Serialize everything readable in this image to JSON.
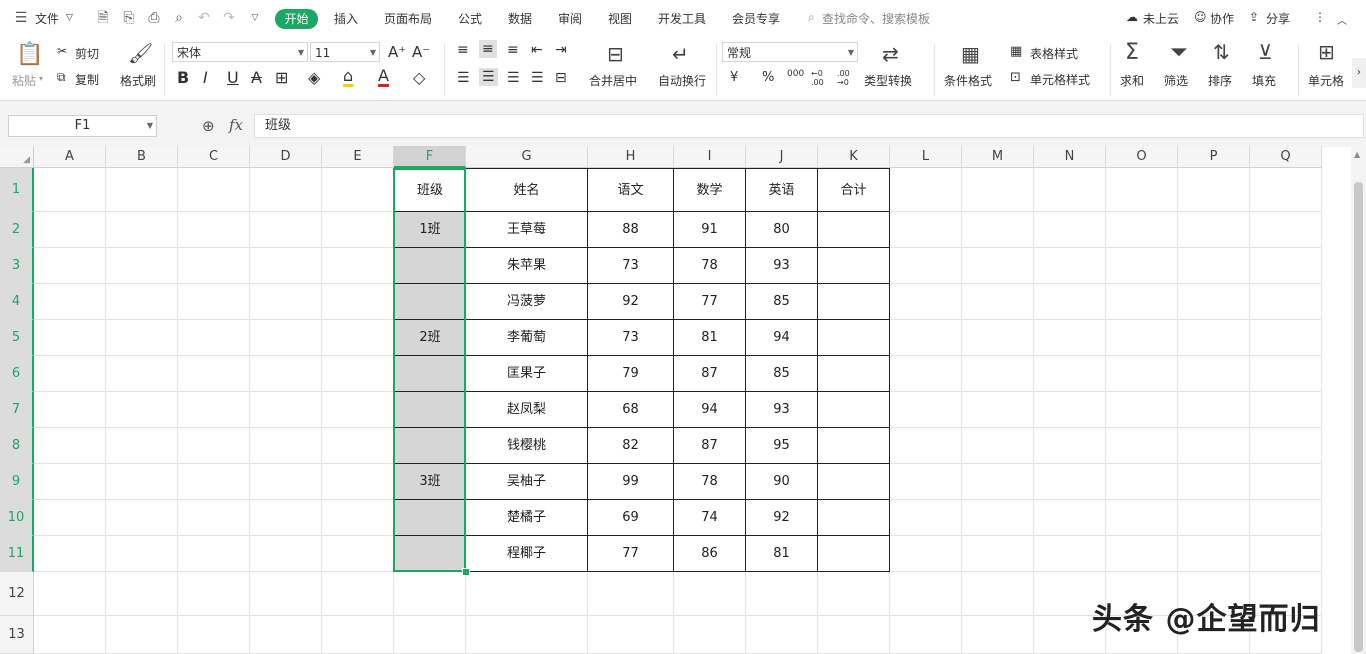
{
  "menubar": {
    "file_label": "文件",
    "tabs": [
      "开始",
      "插入",
      "页面布局",
      "公式",
      "数据",
      "审阅",
      "视图",
      "开发工具",
      "会员专享"
    ],
    "active_tab": "开始",
    "search_placeholder": "查找命令、搜索模板",
    "cloud_label": "未上云",
    "collab_label": "协作",
    "share_label": "分享"
  },
  "ribbon": {
    "paste": "粘贴",
    "cut": "剪切",
    "copy": "复制",
    "format_painter": "格式刷",
    "font_name": "宋体",
    "font_size": "11",
    "merge_center": "合并居中",
    "wrap_text": "自动换行",
    "number_format": "常规",
    "type_convert": "类型转换",
    "cond_format": "条件格式",
    "table_style": "表格样式",
    "cell_style": "单元格样式",
    "sum": "求和",
    "filter": "筛选",
    "sort": "排序",
    "fill": "填充",
    "cell": "单元格",
    "currency": "¥",
    "percent": "%",
    "thousands": "000",
    "inc_decimal": "←0 .00",
    "dec_decimal": ".00 →0"
  },
  "formula": {
    "name_box": "F1",
    "fx": "fx",
    "value": "班级"
  },
  "columns": [
    "A",
    "B",
    "C",
    "D",
    "E",
    "F",
    "G",
    "H",
    "I",
    "J",
    "K",
    "L",
    "M",
    "N",
    "O",
    "P",
    "Q"
  ],
  "rows": [
    "1",
    "2",
    "3",
    "4",
    "5",
    "6",
    "7",
    "8",
    "9",
    "10",
    "11",
    "12",
    "13"
  ],
  "table": {
    "headers": [
      "班级",
      "姓名",
      "语文",
      "数学",
      "英语",
      "合计"
    ],
    "rows": [
      [
        "1班",
        "王草莓",
        "88",
        "91",
        "80",
        ""
      ],
      [
        "",
        "朱苹果",
        "73",
        "78",
        "93",
        ""
      ],
      [
        "",
        "冯菠萝",
        "92",
        "77",
        "85",
        ""
      ],
      [
        "2班",
        "李葡萄",
        "73",
        "81",
        "94",
        ""
      ],
      [
        "",
        "匡果子",
        "79",
        "87",
        "85",
        ""
      ],
      [
        "",
        "赵凤梨",
        "68",
        "94",
        "93",
        ""
      ],
      [
        "",
        "钱樱桃",
        "82",
        "87",
        "95",
        ""
      ],
      [
        "3班",
        "吴柚子",
        "99",
        "78",
        "90",
        ""
      ],
      [
        "",
        "楚橘子",
        "69",
        "74",
        "92",
        ""
      ],
      [
        "",
        "程椰子",
        "77",
        "86",
        "81",
        ""
      ]
    ]
  },
  "watermark": "头条 @企望而归",
  "colors": {
    "accent": "#1aa864"
  }
}
